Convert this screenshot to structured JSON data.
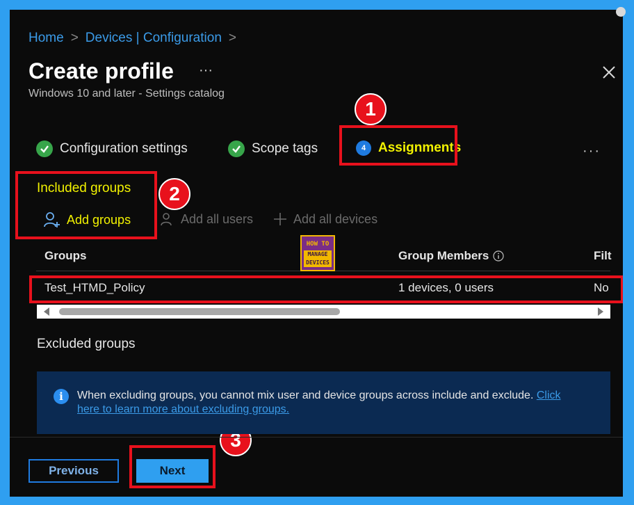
{
  "breadcrumb": {
    "items": [
      "Home",
      "Devices | Configuration"
    ],
    "separator": ">"
  },
  "header": {
    "title": "Create profile",
    "more": "···",
    "subtitle": "Windows 10 and later - Settings catalog"
  },
  "steps": [
    {
      "label": "Configuration settings",
      "state": "completed"
    },
    {
      "label": "Scope tags",
      "state": "completed"
    },
    {
      "label": "Assignments",
      "state": "current",
      "number": "4"
    }
  ],
  "steps_more": "···",
  "annotations": [
    "1",
    "2",
    "3"
  ],
  "included": {
    "label": "Included groups",
    "toolbar": {
      "add_groups": "Add groups",
      "add_all_users": "Add all users",
      "add_all_devices": "Add all devices"
    },
    "columns": {
      "groups": "Groups",
      "members": "Group Members",
      "filter": "Filt"
    },
    "rows": [
      {
        "group": "Test_HTMD_Policy",
        "members": "1 devices, 0 users",
        "filter": "No"
      }
    ]
  },
  "logo": {
    "line1": "HOW TO",
    "line2": "MANAGE",
    "line3": "DEVICES"
  },
  "excluded": {
    "label": "Excluded groups",
    "info_text": "When excluding groups, you cannot mix user and device groups across include and exclude.",
    "info_link_a": "Click",
    "info_link_b": "here to learn more about excluding groups."
  },
  "footer": {
    "previous": "Previous",
    "next": "Next"
  },
  "colors": {
    "accent": "#2f9ff0",
    "highlight": "#f2f200",
    "annotation_red": "#e8111c",
    "check_green": "#37a54a"
  }
}
